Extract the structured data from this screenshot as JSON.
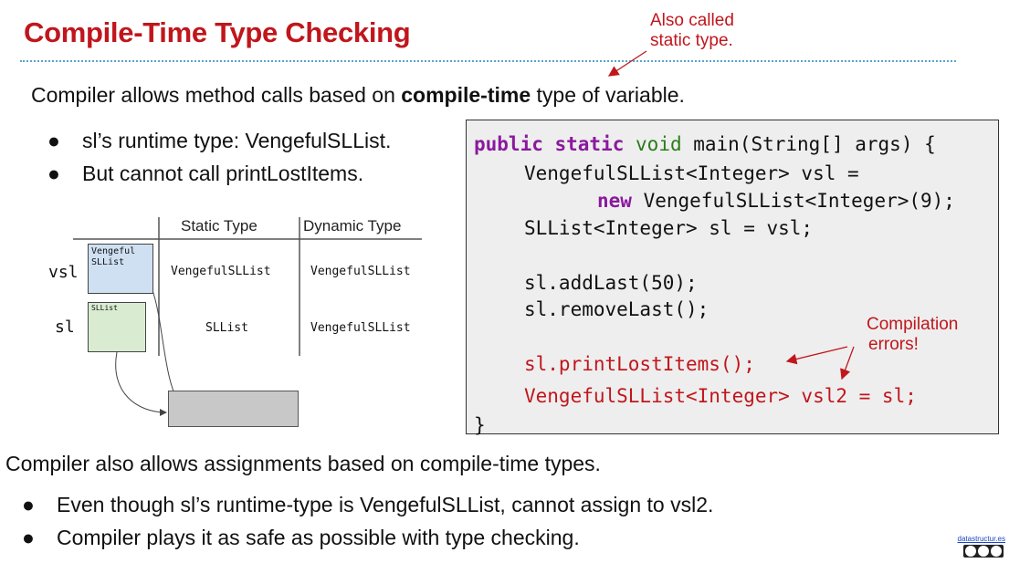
{
  "slide": {
    "title": "Compile-Time Type Checking",
    "note_top_line1": "Also called",
    "note_top_line2": "static type.",
    "intro_prefix": "Compiler allows method calls based on ",
    "intro_bold": "compile-time",
    "intro_suffix": " type of variable.",
    "bullets_top": [
      "sl’s runtime type: VengefulSLList.",
      "But cannot call printLostItems."
    ],
    "bullet_glyph": "●",
    "table": {
      "col_static": "Static Type",
      "col_dynamic": "Dynamic Type",
      "rows": [
        {
          "var": "vsl",
          "box_label_line1": "Vengeful",
          "box_label_line2": "SLList",
          "static": "VengefulSLList",
          "dynamic": "VengefulSLList"
        },
        {
          "var": "sl",
          "box_label_line1": "SLList",
          "box_label_line2": "",
          "static": "SLList",
          "dynamic": "VengefulSLList"
        }
      ]
    },
    "code": {
      "line1_kw": "public static",
      "line1_type": "void",
      "line1_rest": " main(String[] args) {",
      "line2": "VengefulSLList<Integer> vsl =",
      "line3_kw": "new",
      "line3_rest": " VengefulSLList<Integer>(9);",
      "line4": "SLList<Integer> sl = vsl;",
      "line5": "sl.addLast(50);",
      "line6": "sl.removeLast();",
      "line7": "sl.printLostItems();",
      "line8": "VengefulSLList<Integer> vsl2 = sl;",
      "line9": "}"
    },
    "note_errors_line1": "Compilation",
    "note_errors_line2": "errors!",
    "outro": "Compiler also allows assignments based on compile-time types.",
    "bullets_bottom": [
      "Even though sl’s runtime-type is VengefulSLList, cannot assign to vsl2.",
      "Compiler plays it as safe as possible with type checking."
    ],
    "footer_link": "datastructur.es",
    "colors": {
      "title_red": "#c0161c",
      "box_blue": "#cfe0f3",
      "box_green": "#d9ecd2",
      "object_gray": "#c8c8c8",
      "code_bg": "#eeeeee",
      "keyword_purple": "#8a1a9e",
      "type_green": "#2a7a1a"
    },
    "icons": {
      "license_badge": "cc-by-nc-sa-icon"
    }
  }
}
